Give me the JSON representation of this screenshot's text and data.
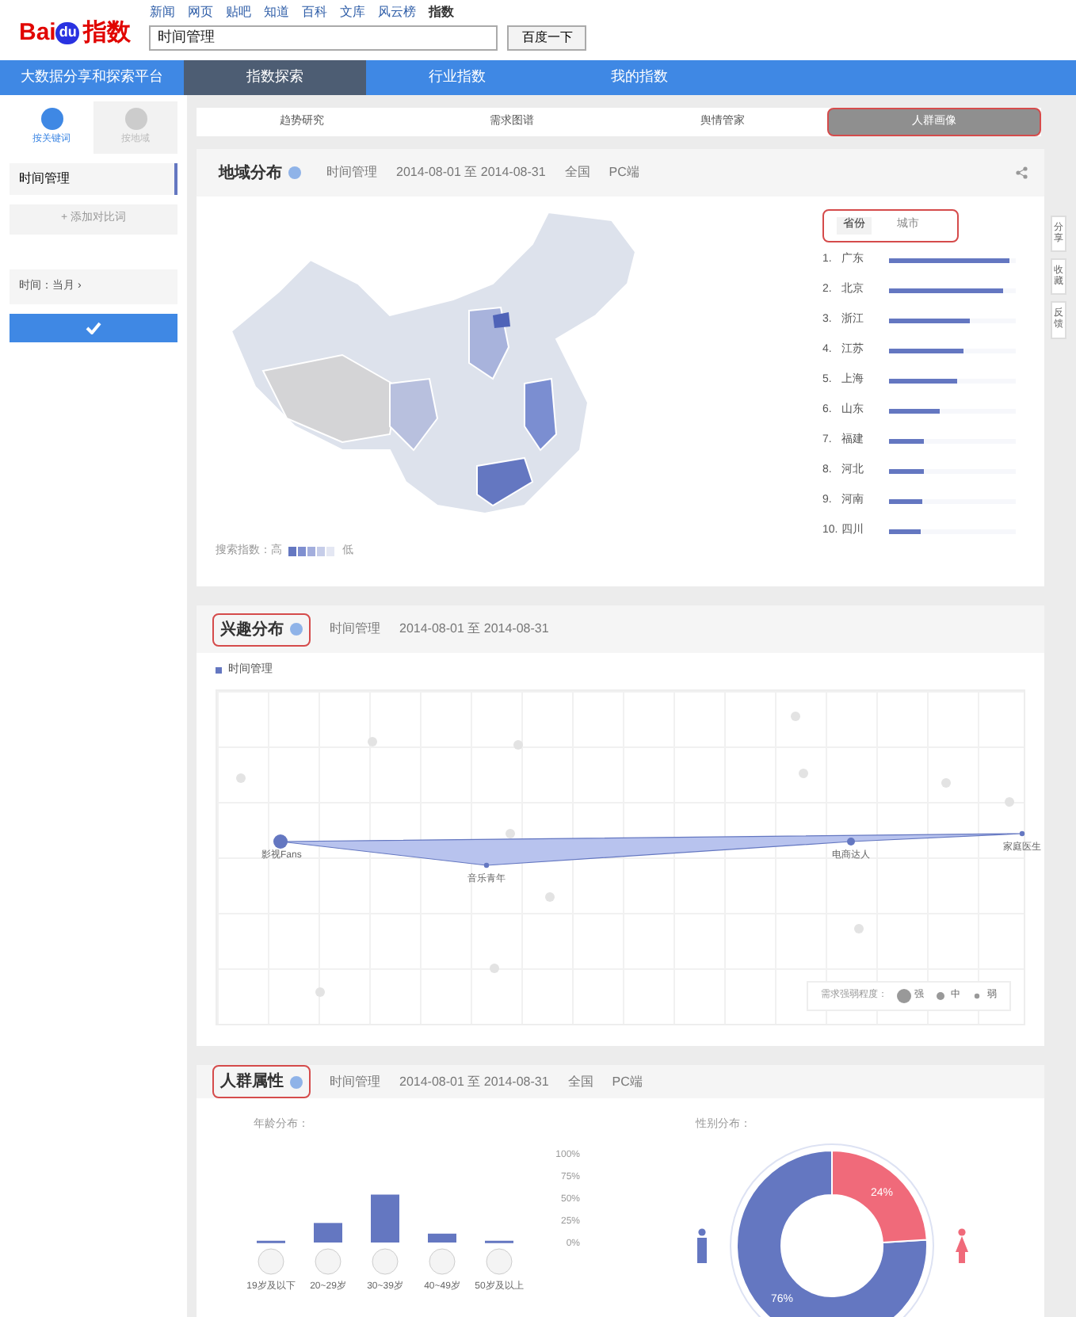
{
  "header": {
    "nav_links": [
      {
        "label": "新闻",
        "selected": false
      },
      {
        "label": "网页",
        "selected": false
      },
      {
        "label": "贴吧",
        "selected": false
      },
      {
        "label": "知道",
        "selected": false
      },
      {
        "label": "百科",
        "selected": false
      },
      {
        "label": "文库",
        "selected": false
      },
      {
        "label": "风云榜",
        "selected": false
      },
      {
        "label": "指数",
        "selected": true
      }
    ],
    "logo_text": "Bai",
    "logo_du": "du",
    "logo_suffix": "指数",
    "search_value": "时间管理",
    "search_button": "百度一下"
  },
  "nav": {
    "platform_title": "大数据分享和探索平台",
    "items": [
      {
        "label": "指数探索",
        "selected": true
      },
      {
        "label": "行业指数",
        "selected": false
      },
      {
        "label": "我的指数",
        "selected": false
      }
    ]
  },
  "sidebar": {
    "modes": [
      {
        "label": "按关键词",
        "selected": true
      },
      {
        "label": "按地域",
        "selected": false
      }
    ],
    "keywords": [
      "时间管理"
    ],
    "add_keyword": "+ 添加对比词",
    "time_filter": "时间：当月 ›"
  },
  "tabs": [
    {
      "label": "趋势研究",
      "selected": false
    },
    {
      "label": "需求图谱",
      "selected": false
    },
    {
      "label": "舆情管家",
      "selected": false
    },
    {
      "label": "人群画像",
      "selected": true
    }
  ],
  "side_tools": [
    "分享",
    "收藏",
    "反馈"
  ],
  "region": {
    "title": "地域分布",
    "meta": [
      "时间管理",
      "2014-08-01 至 2014-08-31",
      "全国",
      "PC端"
    ],
    "toggle": [
      {
        "label": "省份",
        "selected": true
      },
      {
        "label": "城市",
        "selected": false
      }
    ],
    "ranking": [
      {
        "rank": "1.",
        "name": "广东",
        "level": 0.95
      },
      {
        "rank": "2.",
        "name": "北京",
        "level": 0.9
      },
      {
        "rank": "3.",
        "name": "浙江",
        "level": 0.64
      },
      {
        "rank": "4.",
        "name": "江苏",
        "level": 0.59
      },
      {
        "rank": "5.",
        "name": "上海",
        "level": 0.54
      },
      {
        "rank": "6.",
        "name": "山东",
        "level": 0.4
      },
      {
        "rank": "7.",
        "name": "福建",
        "level": 0.28
      },
      {
        "rank": "8.",
        "name": "河北",
        "level": 0.28
      },
      {
        "rank": "9.",
        "name": "河南",
        "level": 0.26
      },
      {
        "rank": "10.",
        "name": "四川",
        "level": 0.25
      }
    ],
    "legend_high": "搜索指数：高",
    "legend_low": "低"
  },
  "interest": {
    "title": "兴趣分布",
    "meta": [
      "时间管理",
      "2014-08-01 至 2014-08-31"
    ],
    "legend": "时间管理",
    "points": [
      {
        "label": "影视Fans",
        "kind": "strong"
      },
      {
        "label": "音乐青年",
        "kind": "weak"
      },
      {
        "label": "电商达人",
        "kind": "medium"
      },
      {
        "label": "家庭医生",
        "kind": "weak"
      }
    ],
    "strength_legend": {
      "label": "需求强弱程度：",
      "items": [
        {
          "label": "强",
          "kind": "strong"
        },
        {
          "label": "中",
          "kind": "medium"
        },
        {
          "label": "弱",
          "kind": "weak"
        }
      ]
    }
  },
  "crowd": {
    "title": "人群属性",
    "meta": [
      "时间管理",
      "2014-08-01 至 2014-08-31",
      "全国",
      "PC端"
    ],
    "age": {
      "label": "年龄分布：",
      "chart_data": {
        "type": "bar",
        "categories": [
          "19岁及以下",
          "20~29岁",
          "30~39岁",
          "40~49岁",
          "50岁及以上"
        ],
        "values": [
          2,
          22,
          54,
          10,
          2
        ],
        "ylim": [
          0,
          100
        ],
        "yticks": [
          {
            "value": 0,
            "label": "0%"
          },
          {
            "value": 25,
            "label": "25%"
          },
          {
            "value": 50,
            "label": "50%"
          },
          {
            "value": 75,
            "label": "75%"
          },
          {
            "value": 100,
            "label": "100%"
          }
        ]
      }
    },
    "gender": {
      "label": "性别分布：",
      "chart_data": {
        "type": "donut",
        "values": [
          76,
          24
        ],
        "colors": [
          "#6477c1",
          "#f06a7a"
        ],
        "value_labels": [
          "76%",
          "24%"
        ]
      }
    }
  }
}
